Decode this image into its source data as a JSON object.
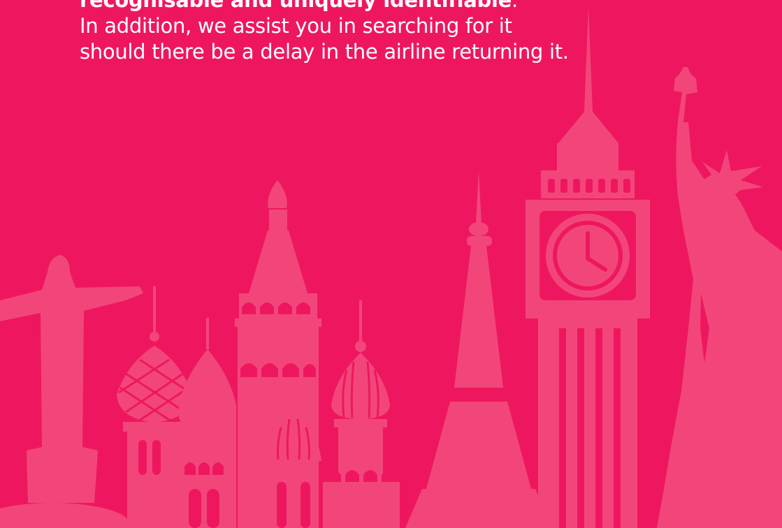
{
  "text": {
    "line1_bold": "recognisable and uniquely identifiable",
    "line1_suffix": ".",
    "line2": "In addition, we assist you in searching for it",
    "line3": "should there be a delay in the airline returning it."
  },
  "colors": {
    "background": "#ee175f",
    "landmarks": "#f2467a",
    "text": "#ffffff"
  },
  "illustration": {
    "landmarks": [
      "christ-the-redeemer",
      "st-basils-cathedral",
      "eiffel-tower",
      "big-ben",
      "statue-of-liberty"
    ]
  }
}
